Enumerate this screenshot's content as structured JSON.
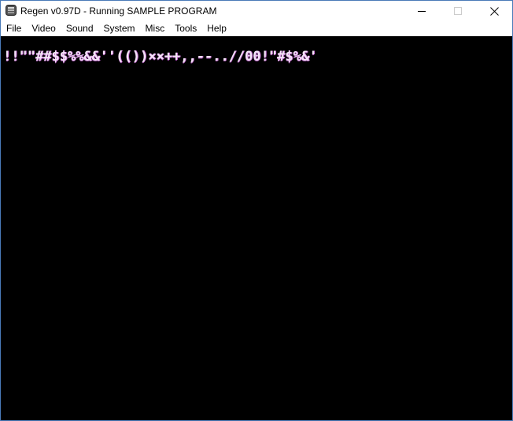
{
  "window": {
    "title": "Regen v0.97D - Running SAMPLE PROGRAM",
    "app_icon": "regen-app-icon",
    "controls": {
      "minimize_icon": "minimize-icon",
      "maximize_icon": "maximize-icon",
      "close_icon": "close-icon"
    }
  },
  "menubar": {
    "items": [
      {
        "label": "File"
      },
      {
        "label": "Video"
      },
      {
        "label": "Sound"
      },
      {
        "label": "System"
      },
      {
        "label": "Misc"
      },
      {
        "label": "Tools"
      },
      {
        "label": "Help"
      }
    ]
  },
  "screen": {
    "background": "#000000",
    "text_color": "#f3e4f6",
    "text_shadow_color": "#c86fd3",
    "line1": "!!\"\"##$$%%&&''(())××++,,--..//00!\"#$%&'"
  },
  "colors": {
    "window_border": "#4a7ab8",
    "titlebar_bg": "#ffffff",
    "menubar_bg": "#ffffff"
  }
}
